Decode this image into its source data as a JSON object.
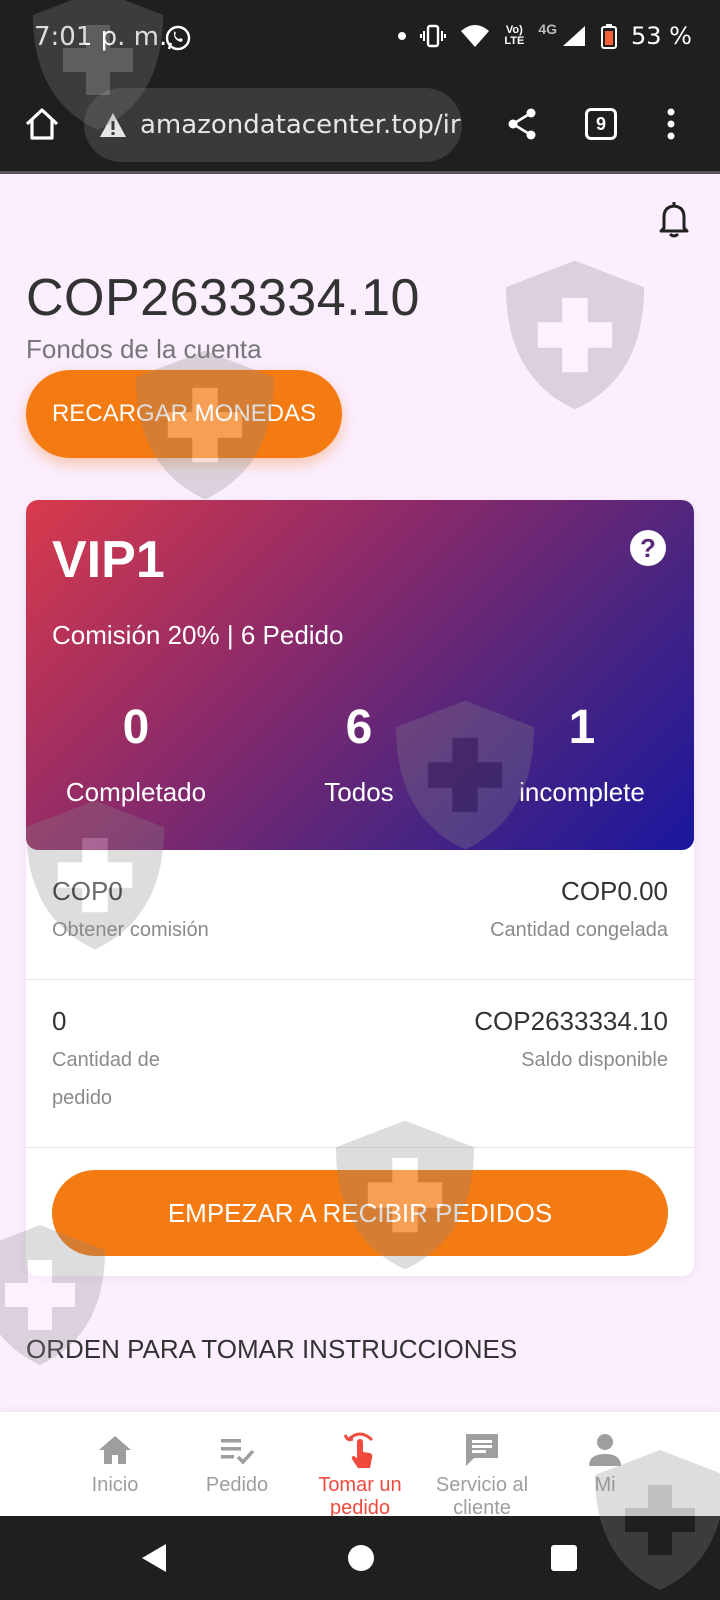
{
  "status_bar": {
    "time": "7:01 p. m.",
    "network_label_top": "Vo)",
    "network_label_bottom": "LTE",
    "network_4g": "4G",
    "battery": "53 %"
  },
  "browser": {
    "url": "amazondatacenter.top/ir",
    "tab_count": "9"
  },
  "account": {
    "balance": "COP2633334.10",
    "balance_label": "Fondos de la cuenta",
    "recharge_label": "RECARGAR MONEDAS"
  },
  "vip": {
    "title": "VIP1",
    "help": "?",
    "subtitle": "Comisión 20% | 6 Pedido",
    "stats": [
      {
        "value": "0",
        "label": "Completado"
      },
      {
        "value": "6",
        "label": "Todos"
      },
      {
        "value": "1",
        "label": "incomplete"
      }
    ]
  },
  "details": {
    "commission_value": "COP0",
    "commission_label": "Obtener comisión",
    "frozen_value": "COP0.00",
    "frozen_label": "Cantidad congelada",
    "orders_value": "0",
    "orders_label_1": "Cantidad de",
    "orders_label_2": "pedido",
    "available_value": "COP2633334.10",
    "available_label": "Saldo disponible",
    "start_label": "EMPEZAR A RECIBIR PEDIDOS"
  },
  "instructions_title": "ORDEN PARA TOMAR INSTRUCCIONES",
  "bottom_nav": {
    "active_color": "#f04a3e",
    "items": [
      {
        "label": "Inicio",
        "icon": "home-icon"
      },
      {
        "label": "Pedido",
        "icon": "list-check-icon"
      },
      {
        "label": "Tomar un pedido",
        "icon": "tap-icon"
      },
      {
        "label": "Servicio al cliente",
        "icon": "chat-icon"
      },
      {
        "label": "Mi",
        "icon": "person-icon"
      }
    ]
  },
  "colors": {
    "accent": "#f47a12",
    "vip_gradient_start": "#d93a4b",
    "vip_gradient_end": "#1a169e"
  }
}
